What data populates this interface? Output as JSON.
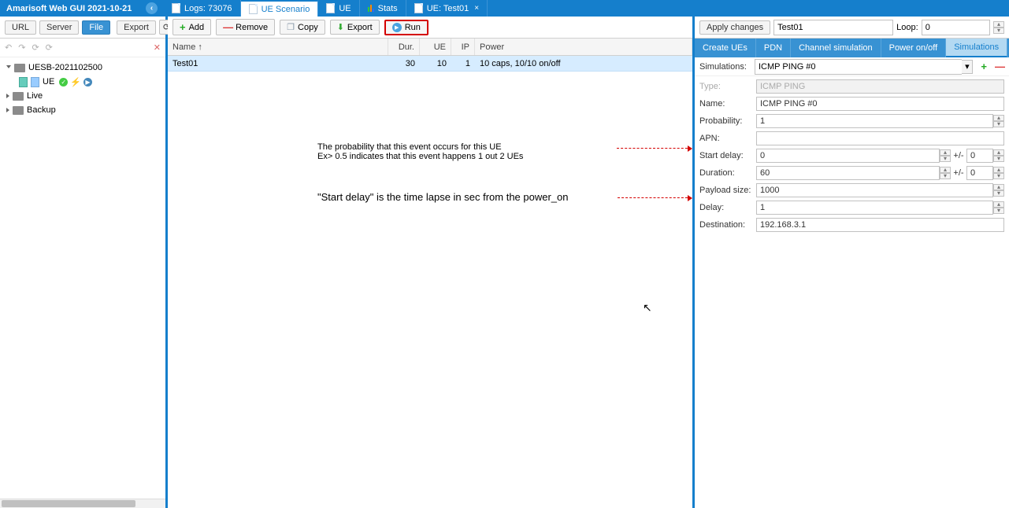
{
  "header": {
    "title": "Amarisoft Web GUI 2021-10-21"
  },
  "top_tabs": [
    {
      "label": "Logs: 73076",
      "icon": "doc"
    },
    {
      "label": "UE Scenario",
      "icon": "doc",
      "active": true
    },
    {
      "label": "UE",
      "icon": "doc"
    },
    {
      "label": "Stats",
      "icon": "stats"
    },
    {
      "label": "UE: Test01",
      "icon": "doc",
      "close": true
    }
  ],
  "left_toolbar": {
    "url": "URL",
    "server": "Server",
    "file": "File",
    "export": "Export"
  },
  "tree": {
    "root": "UESB-2021102500",
    "ue": "UE",
    "live": "Live",
    "backup": "Backup"
  },
  "center_toolbar": {
    "add": "Add",
    "remove": "Remove",
    "copy": "Copy",
    "export": "Export",
    "run": "Run"
  },
  "grid": {
    "cols": {
      "name": "Name ↑",
      "dur": "Dur.",
      "ue": "UE",
      "ip": "IP",
      "power": "Power"
    },
    "row": {
      "name": "Test01",
      "dur": "30",
      "ue": "10",
      "ip": "1",
      "power": "10 caps, 10/10 on/off"
    }
  },
  "annotations": {
    "prob1": "The probability that this event occurs for this UE",
    "prob2": "Ex> 0.5 indicates that this event happens 1 out 2 UEs",
    "start": "\"Start delay\" is the time lapse in sec from the power_on"
  },
  "right": {
    "apply": "Apply changes",
    "name_input": "Test01",
    "loop_lbl": "Loop:",
    "loop_val": "0",
    "tabs": {
      "create": "Create UEs",
      "pdn": "PDN",
      "chan": "Channel simulation",
      "power": "Power on/off",
      "sim": "Simulations"
    },
    "sim_lbl": "Simulations:",
    "sim_sel": "ICMP PING #0",
    "fields": {
      "type_lbl": "Type:",
      "type_val": "ICMP PING",
      "name_lbl": "Name:",
      "name_val": "ICMP PING #0",
      "prob_lbl": "Probability:",
      "prob_val": "1",
      "apn_lbl": "APN:",
      "apn_val": "",
      "sd_lbl": "Start delay:",
      "sd_val": "0",
      "sd_pm": "+/-",
      "sd_pm_val": "0",
      "dur_lbl": "Duration:",
      "dur_val": "60",
      "dur_pm": "+/-",
      "dur_pm_val": "0",
      "pl_lbl": "Payload size:",
      "pl_val": "1000",
      "del_lbl": "Delay:",
      "del_val": "1",
      "dest_lbl": "Destination:",
      "dest_val": "192.168.3.1"
    }
  }
}
